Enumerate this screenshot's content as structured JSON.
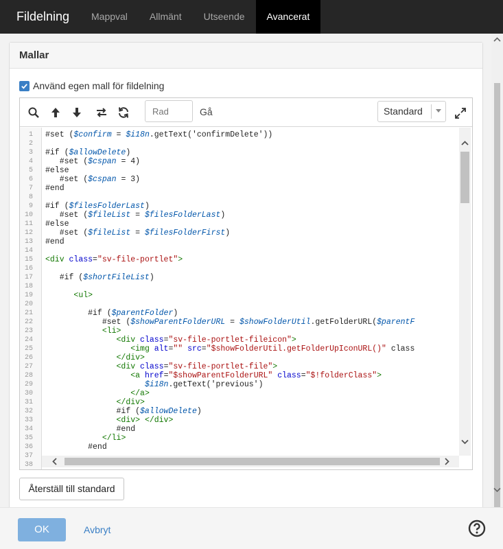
{
  "header": {
    "title": "Fildelning",
    "tabs": [
      {
        "label": "Mappval"
      },
      {
        "label": "Allmänt"
      },
      {
        "label": "Utseende"
      },
      {
        "label": "Avancerat"
      }
    ]
  },
  "panel": {
    "title": "Mallar",
    "checkbox_label": "Använd egen mall för fildelning",
    "checkbox_checked": true
  },
  "editor": {
    "row_placeholder": "Rad",
    "go_label": "Gå",
    "theme_select": "Standard",
    "lines": [
      "#set ($confirm = $i18n.getText('confirmDelete'))",
      "",
      "#if ($allowDelete)",
      "   #set ($cspan = 4)",
      "#else",
      "   #set ($cspan = 3)",
      "#end",
      "",
      "#if ($filesFolderLast)",
      "   #set ($fileList = $filesFolderLast)",
      "#else",
      "   #set ($fileList = $filesFolderFirst)",
      "#end",
      "",
      "<div class=\"sv-file-portlet\">",
      "",
      "   #if ($shortFileList)",
      "",
      "      <ul>",
      "",
      "         #if ($parentFolder)",
      "            #set ($showParentFolderURL = $showFolderUtil.getFolderURL($parentF",
      "            <li>",
      "               <div class=\"sv-file-portlet-fileicon\">",
      "                  <img alt=\"\" src=\"$showFolderUtil.getFolderUpIconURL()\" class",
      "               </div>",
      "               <div class=\"sv-file-portlet-file\">",
      "                  <a href=\"$showParentFolderURL\" class=\"$!folderClass\">",
      "                     $i18n.getText('previous')",
      "                  </a>",
      "               </div>",
      "               #if ($allowDelete)",
      "               <div> </div>",
      "               #end",
      "            </li>",
      "         #end",
      "",
      ""
    ]
  },
  "buttons": {
    "reset": "Återställ till standard",
    "ok": "OK",
    "cancel": "Avbryt"
  },
  "icons": {
    "search": "search-icon",
    "up": "arrow-up-icon",
    "down": "arrow-down-icon",
    "replace": "replace-icon",
    "refresh": "refresh-icon",
    "expand": "expand-icon",
    "help": "help-icon"
  },
  "colors": {
    "accent": "#3a7fc5",
    "ok_button": "#7fb0df",
    "topbar": "#262626"
  }
}
